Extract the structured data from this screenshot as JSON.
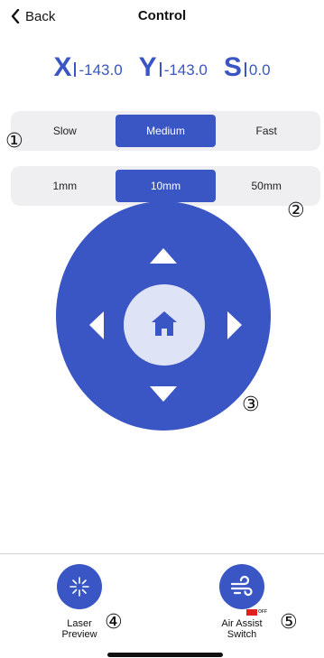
{
  "header": {
    "back_label": "Back",
    "title": "Control"
  },
  "position": {
    "x": {
      "axis": "X",
      "value": "-143.0"
    },
    "y": {
      "axis": "Y",
      "value": "-143.0"
    },
    "s": {
      "axis": "S",
      "value": "0.0"
    }
  },
  "speed": {
    "options": [
      "Slow",
      "Medium",
      "Fast"
    ],
    "selected": "Medium"
  },
  "step": {
    "options": [
      "1mm",
      "10mm",
      "50mm"
    ],
    "selected": "10mm"
  },
  "markers": {
    "m1": "①",
    "m2": "②",
    "m3": "③",
    "m4": "④",
    "m5": "⑤"
  },
  "jog_pad": {
    "icons": [
      "up-arrow-icon",
      "down-arrow-icon",
      "left-arrow-icon",
      "right-arrow-icon",
      "home-icon"
    ],
    "colors": {
      "pad": "#3a56c5",
      "center": "#dfe3f6",
      "arrow": "#ffffff"
    }
  },
  "bottom_bar": {
    "laser_preview": {
      "label_line1": "Laser",
      "label_line2": "Preview",
      "icon": "laser-burst-icon"
    },
    "air_assist": {
      "label_line1": "Air Assist",
      "label_line2": "Switch",
      "icon": "air-flow-icon",
      "state": "OFF"
    }
  },
  "colors": {
    "accent": "#3a56c5",
    "segment_bg": "#efeff1",
    "off_indicator": "#e02020"
  }
}
